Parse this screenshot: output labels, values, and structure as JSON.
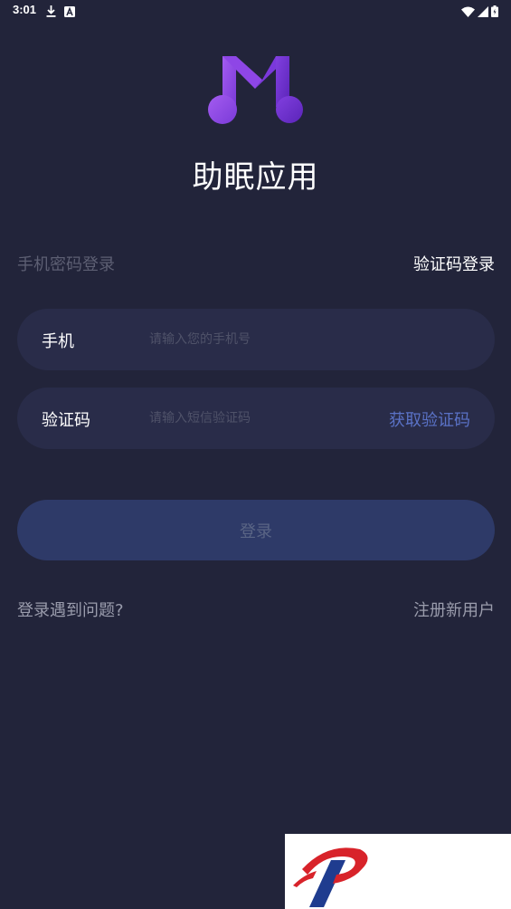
{
  "status_bar": {
    "time": "3:01",
    "left_icons": [
      "download-icon",
      "font-a-icon"
    ],
    "right_icons": [
      "wifi-icon",
      "cellular-signal-icon",
      "battery-icon"
    ]
  },
  "app": {
    "logo_icon": "music-note-m-logo-icon",
    "title": "助眠应用"
  },
  "login_tabs": {
    "password_tab": "手机密码登录",
    "code_tab": "验证码登录",
    "active": "code_tab"
  },
  "form": {
    "phone_label": "手机",
    "phone_placeholder": "请输入您的手机号",
    "phone_value": "",
    "code_label": "验证码",
    "code_placeholder": "请输入短信验证码",
    "code_value": "",
    "get_code_label": "获取验证码"
  },
  "login_button": {
    "label": "登录"
  },
  "bottom_links": {
    "help": "登录遇到问题?",
    "register": "注册新用户"
  },
  "colors": {
    "background": "#22243a",
    "field_background": "#292c49",
    "button_background": "#2e3a68",
    "accent": "#5a72c6",
    "logo_purple_light": "#9a52e8",
    "logo_purple_dark": "#6a2fc8",
    "watermark_red": "#d8232a",
    "watermark_blue": "#1f3c8f"
  },
  "watermark": {
    "icon": "p-brand-logo-icon"
  }
}
